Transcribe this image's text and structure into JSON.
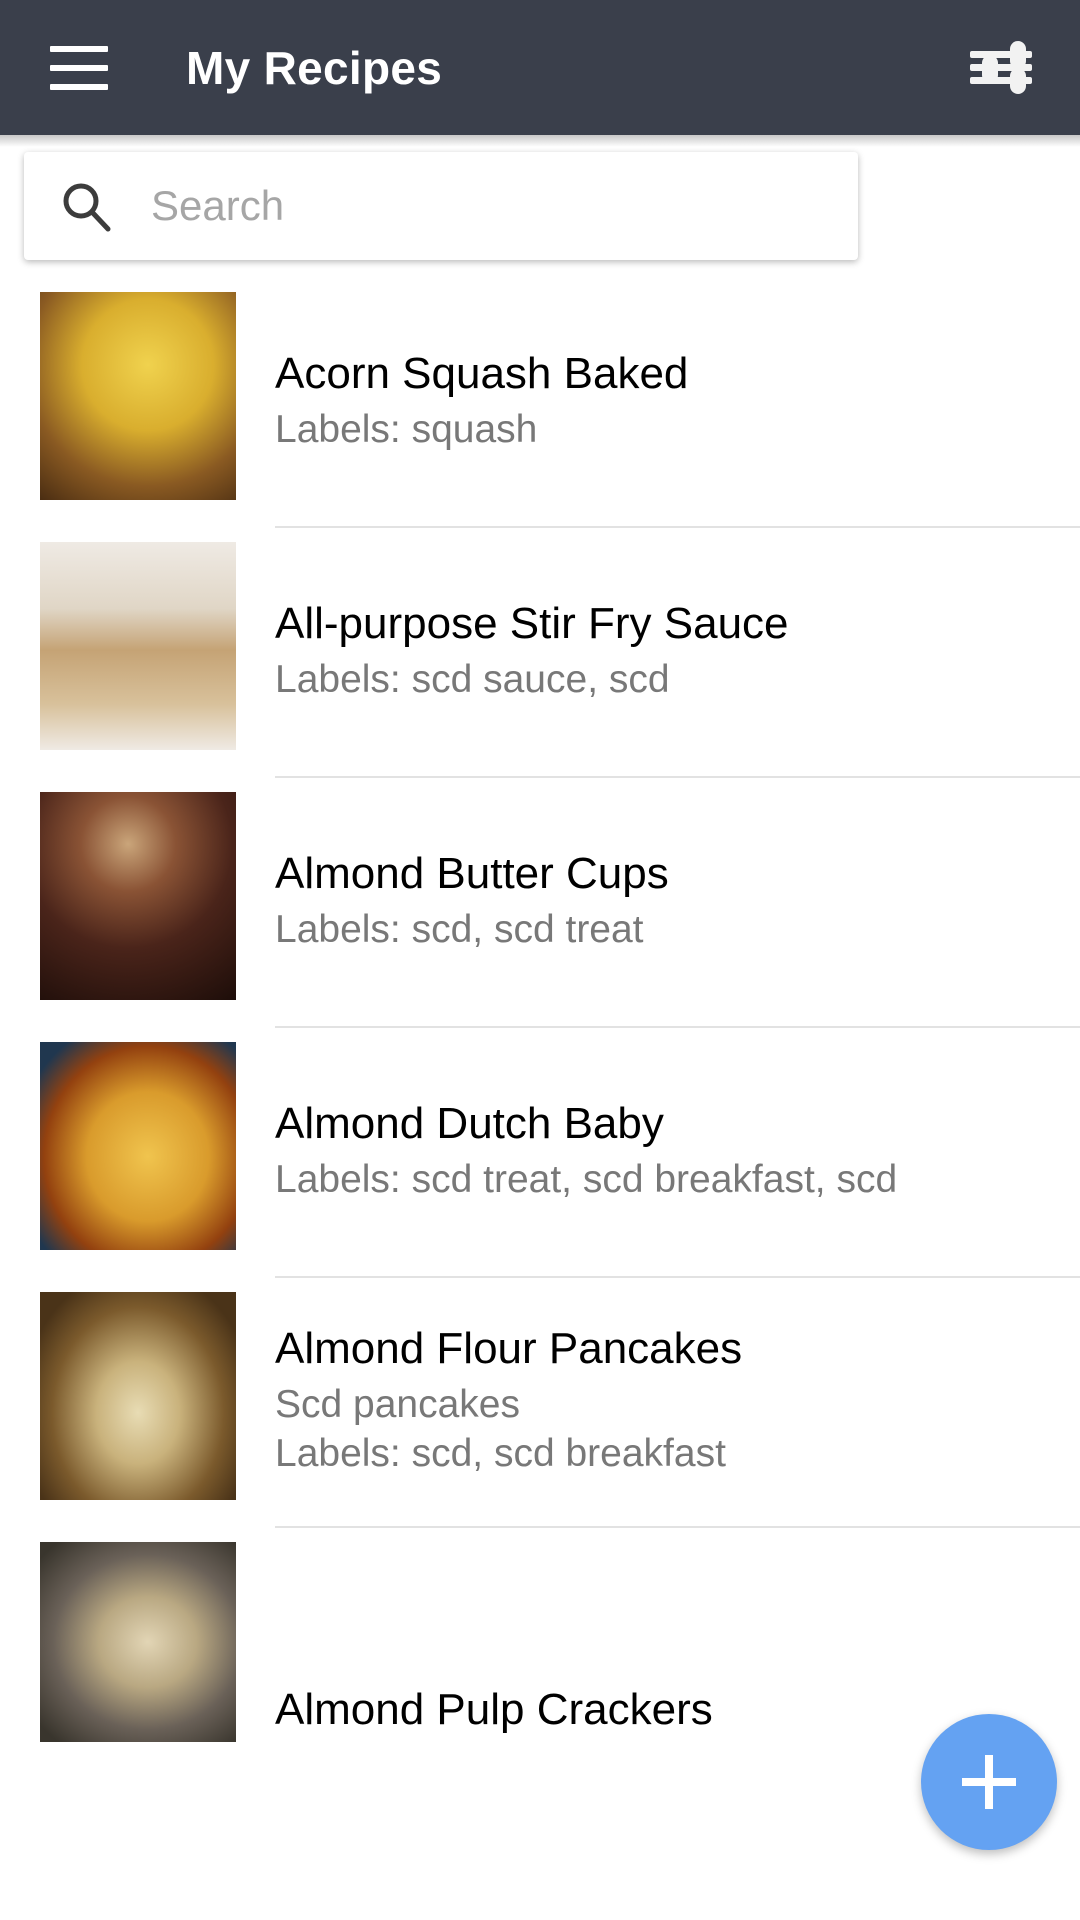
{
  "header": {
    "menu_icon": "hamburger-menu-icon",
    "title": "My Recipes",
    "filter_icon": "tune-sliders-icon",
    "background_color": "#3a3f4b"
  },
  "search": {
    "icon": "search-icon",
    "placeholder": "Search",
    "value": ""
  },
  "list": {
    "items": [
      {
        "title": "Acorn Squash Baked",
        "subtitle": "",
        "labels": "Labels: squash",
        "thumb_colors": [
          "#c9a43a",
          "#e8c23d",
          "#8a5a26",
          "#5c3a1a"
        ]
      },
      {
        "title": "All-purpose Stir Fry Sauce",
        "subtitle": "",
        "labels": "Labels: scd sauce, scd",
        "thumb_colors": [
          "#d8cfc5",
          "#6b4a2a",
          "#2d1a0c",
          "#bfa98e"
        ]
      },
      {
        "title": "Almond Butter Cups",
        "subtitle": "",
        "labels": "Labels: scd, scd treat",
        "thumb_colors": [
          "#2a1410",
          "#6d3f2c",
          "#3d201a",
          "#c8a27a"
        ]
      },
      {
        "title": "Almond Dutch Baby",
        "subtitle": "",
        "labels": "Labels: scd treat, scd breakfast, scd",
        "thumb_colors": [
          "#7fa86b",
          "#e8bb4a",
          "#9a4a18",
          "#1d3b5c"
        ]
      },
      {
        "title": "Almond Flour Pancakes",
        "subtitle": "Scd pancakes",
        "labels": "Labels: scd, scd breakfast",
        "thumb_colors": [
          "#b9b0a4",
          "#e5d9b8",
          "#6b4a2a",
          "#8a8f6a"
        ]
      },
      {
        "title": "Almond Pulp Crackers",
        "subtitle": "",
        "labels": "",
        "thumb_colors": [
          "#6e6a63",
          "#d8cbb0",
          "#3b372f",
          "#a79a80"
        ]
      }
    ]
  },
  "fab": {
    "icon": "plus-icon",
    "label": "+",
    "color": "#64a2f2"
  }
}
